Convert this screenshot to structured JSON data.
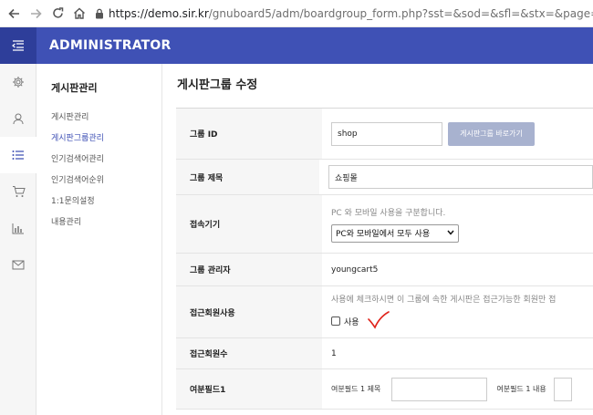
{
  "browser": {
    "url_host": "https://demo.sir.kr",
    "url_path": "/gnuboard5/adm/boardgroup_form.php?sst=&sod=&sfl=&stx=&page=&w=u..."
  },
  "header": {
    "brand": "ADMINISTRATOR"
  },
  "rail_icons": [
    "gear-icon",
    "user-icon",
    "list-icon",
    "cart-icon",
    "chart-icon",
    "mail-icon"
  ],
  "sidemenu": {
    "title": "게시판관리",
    "items": [
      "게시판관리",
      "게시판그룹관리",
      "인기검색어관리",
      "인기검색어순위",
      "1:1문의설정",
      "내용관리"
    ],
    "active_index": 1
  },
  "page_title": "게시판그룹 수정",
  "form": {
    "group_id": {
      "label": "그룹 ID",
      "value": "shop",
      "button": "게시판그룹 바로가기"
    },
    "group_subject": {
      "label": "그룹 제목",
      "value": "쇼핑몰"
    },
    "device": {
      "label": "접속기기",
      "help": "PC 와 모바일 사용을 구분합니다.",
      "selected": "PC와 모바일에서 모두 사용"
    },
    "admin": {
      "label": "그룹 관리자",
      "value": "youngcart5"
    },
    "use_access": {
      "label": "접근회원사용",
      "help": "사용에 체크하시면 이 그룹에 속한 게시판은 접근가능한 회원만 접",
      "checkbox_label": "사용"
    },
    "access_count": {
      "label": "접근회원수",
      "value": "1"
    },
    "extra1": {
      "label": "여분필드1",
      "subject_label": "여분필드 1 제목",
      "content_label": "여분필드 1 내용"
    }
  },
  "colors": {
    "accent": "#3f51b5",
    "annotation": "#e0241b"
  }
}
